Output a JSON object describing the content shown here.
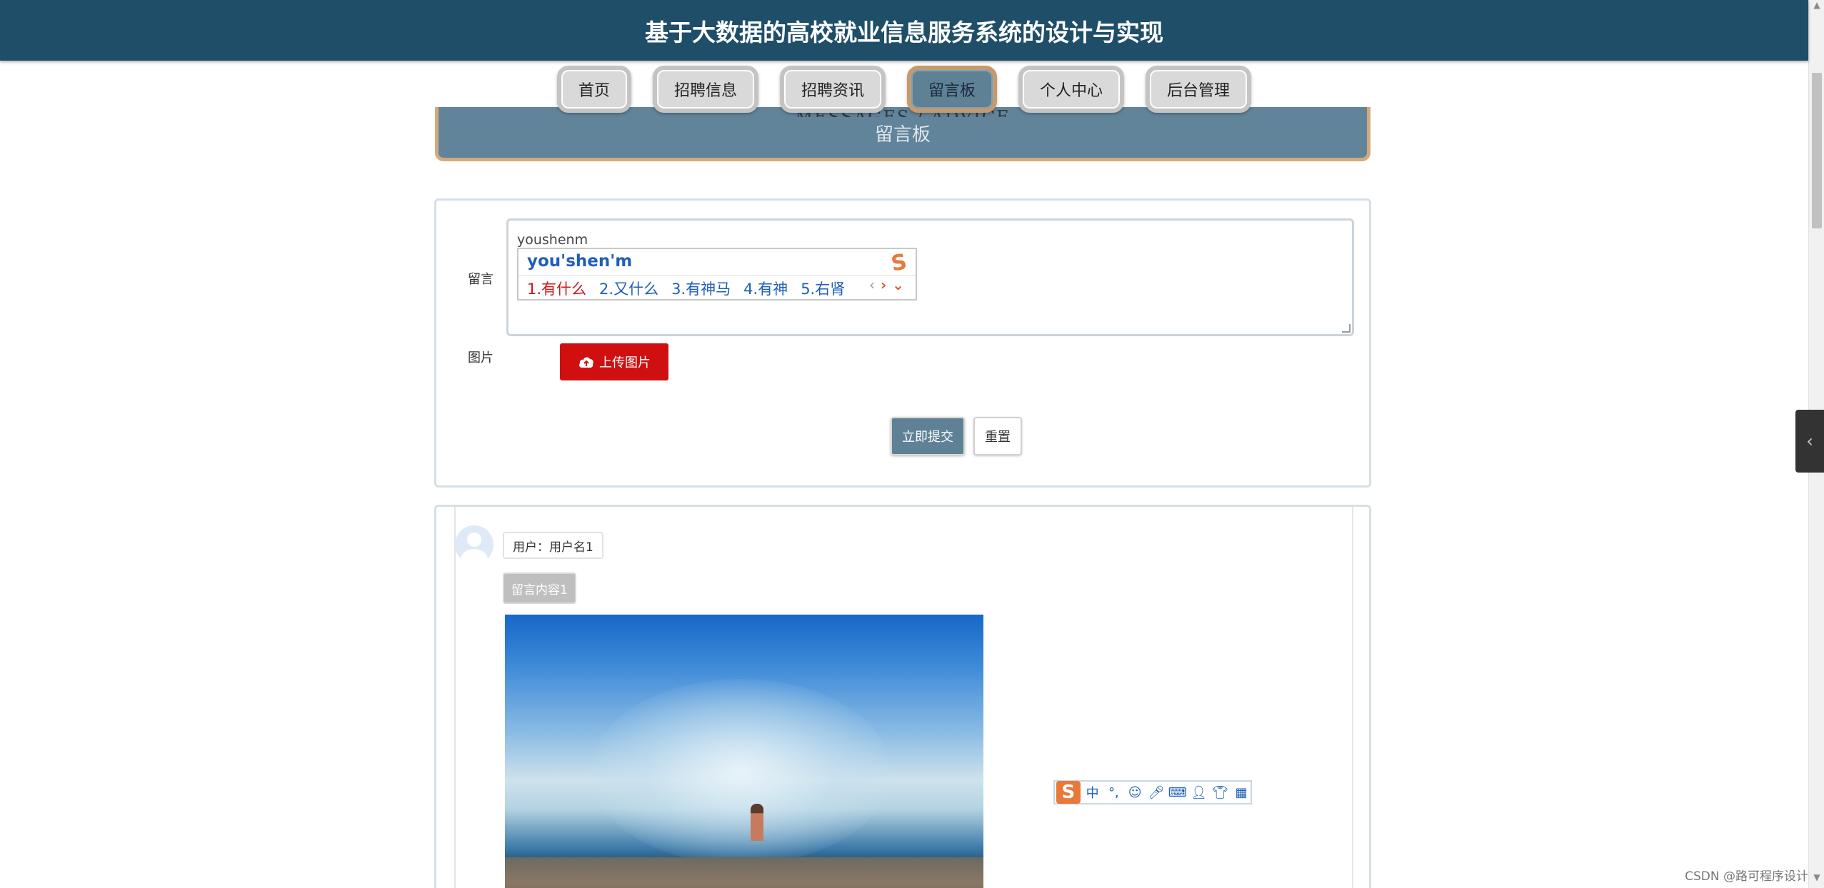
{
  "header": {
    "title": "基于大数据的高校就业信息服务系统的设计与实现"
  },
  "nav": {
    "items": [
      {
        "label": "首页",
        "active": false
      },
      {
        "label": "招聘信息",
        "active": false
      },
      {
        "label": "招聘资讯",
        "active": false
      },
      {
        "label": "留言板",
        "active": true
      },
      {
        "label": "个人中心",
        "active": false
      },
      {
        "label": "后台管理",
        "active": false
      }
    ]
  },
  "banner": {
    "en": "MESSAGES / ADVICE",
    "cn": "留言板"
  },
  "form": {
    "message_label": "留言",
    "message_value": "youshenm",
    "image_label": "图片",
    "upload_label": "上传图片",
    "submit_label": "立即提交",
    "reset_label": "重置"
  },
  "ime": {
    "composition": "you'shen'm",
    "candidates": [
      "1.有什么",
      "2.又什么",
      "3.有神马",
      "4.有神",
      "5.右肾"
    ],
    "logo": "S",
    "bar": {
      "mode": "中",
      "punct": "°,",
      "logo": "S"
    }
  },
  "messages": [
    {
      "user": "用户：用户名1",
      "content": "留言内容1"
    }
  ],
  "watermark": "CSDN @路可程序设计",
  "colors": {
    "header_bg": "#1f4e69",
    "active_nav": "#5e8196",
    "upload_btn": "#d01010",
    "accent_border": "#d3a97e"
  }
}
